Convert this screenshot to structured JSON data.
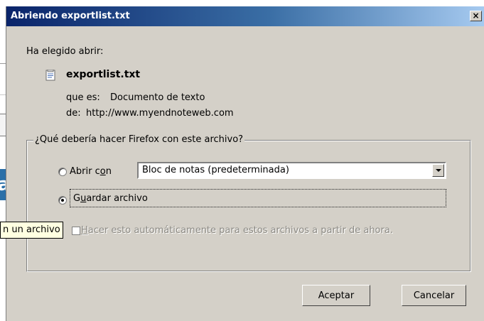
{
  "dialog": {
    "title": "Abriendo exportlist.txt",
    "close_glyph": "×",
    "ask_text": "Ha elegido abrir:",
    "file_name": "exportlist.txt",
    "type_label": "que es:",
    "type_value": "Documento de texto",
    "from_label": "de:",
    "from_value": "http://www.myendnoteweb.com",
    "group_legend": "¿Qué debería hacer Firefox con este archivo?",
    "open_with_label_pre": "Abrir c",
    "open_with_label_key": "o",
    "open_with_label_post": "n",
    "open_with_app": "Bloc de notas (predeterminada)",
    "save_label_pre": "G",
    "save_label_key": "u",
    "save_label_post": "ardar archivo",
    "auto_label_key": "H",
    "auto_label_post": "acer esto automáticamente para estos archivos a partir de ahora.",
    "ok_label": "Aceptar",
    "cancel_label": "Cancelar"
  },
  "tooltip": {
    "text": "n un archivo"
  },
  "background": {
    "blue_fragment": "ia"
  },
  "state": {
    "selected_option": "save",
    "auto_checked": false
  }
}
